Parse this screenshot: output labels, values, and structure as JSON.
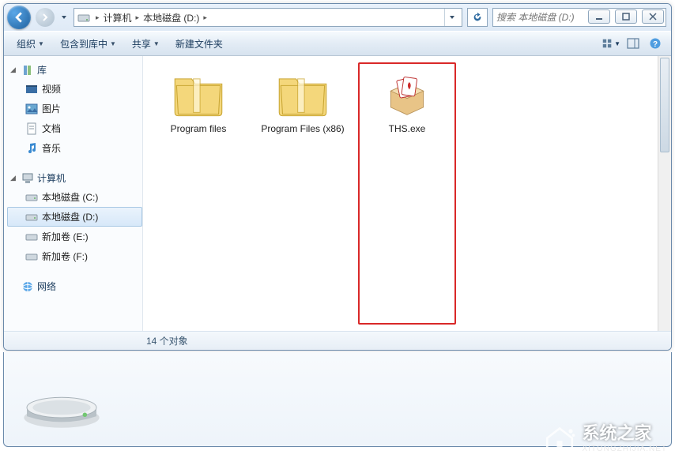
{
  "breadcrumb": {
    "root": "计算机",
    "drive": "本地磁盘 (D:)"
  },
  "search": {
    "placeholder": "搜索 本地磁盘 (D:)"
  },
  "toolbar": {
    "organize": "组织",
    "include": "包含到库中",
    "share": "共享",
    "newfolder": "新建文件夹"
  },
  "sidebar": {
    "libraries": {
      "title": "库",
      "items": [
        "视频",
        "图片",
        "文档",
        "音乐"
      ]
    },
    "computer": {
      "title": "计算机",
      "items": [
        "本地磁盘 (C:)",
        "本地磁盘 (D:)",
        "新加卷 (E:)",
        "新加卷 (F:)"
      ]
    },
    "network": {
      "title": "网络"
    }
  },
  "files": [
    {
      "name": "Program files",
      "type": "folder"
    },
    {
      "name": "Program Files (x86)",
      "type": "folder"
    },
    {
      "name": "THS.exe",
      "type": "exe",
      "highlighted": true
    }
  ],
  "status": {
    "count_label": "14 个对象"
  },
  "watermark": {
    "text": "系统之家",
    "sub": "XITONGZHIJIA.NET"
  }
}
